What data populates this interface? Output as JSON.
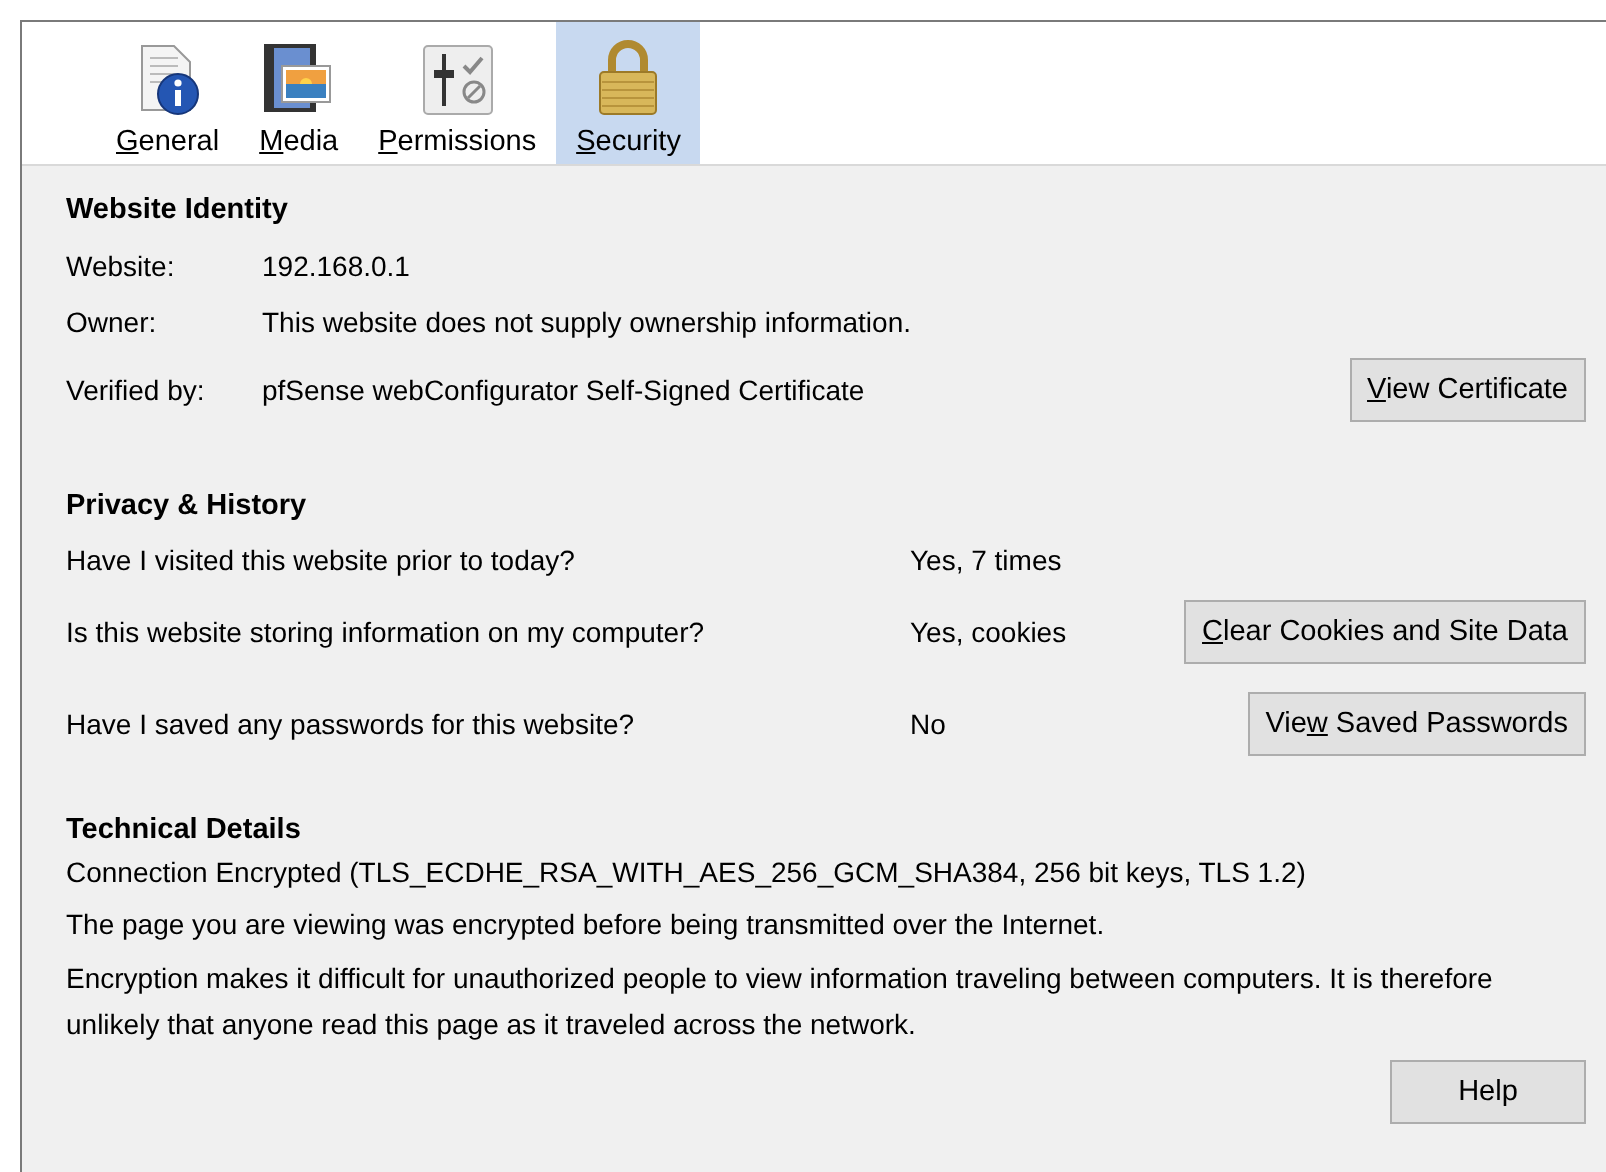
{
  "tabs": [
    {
      "label": "General",
      "selected": false
    },
    {
      "label": "Media",
      "selected": false
    },
    {
      "label": "Permissions",
      "selected": false
    },
    {
      "label": "Security",
      "selected": true
    }
  ],
  "identity": {
    "heading": "Website Identity",
    "rows": [
      {
        "label": "Website:",
        "value": "192.168.0.1"
      },
      {
        "label": "Owner:",
        "value": "This website does not supply ownership information."
      },
      {
        "label": "Verified by:",
        "value": "pfSense webConfigurator Self-Signed Certificate",
        "button": {
          "label": "View Certificate"
        }
      }
    ]
  },
  "privacy": {
    "heading": "Privacy & History",
    "rows": [
      {
        "question": "Have I visited this website prior to today?",
        "answer": "Yes, 7 times"
      },
      {
        "question": "Is this website storing information on my computer?",
        "answer": "Yes, cookies",
        "button": {
          "label": "Clear Cookies and Site Data"
        }
      },
      {
        "question": "Have I saved any passwords for this website?",
        "answer": "No",
        "button": {
          "label": "View Saved Passwords"
        }
      }
    ]
  },
  "technical": {
    "heading": "Technical Details",
    "lines": [
      "Connection Encrypted (TLS_ECDHE_RSA_WITH_AES_256_GCM_SHA384, 256 bit keys, TLS 1.2)",
      "The page you are viewing was encrypted before being transmitted over the Internet.",
      "Encryption makes it difficult for unauthorized people to view information traveling between computers. It is therefore unlikely that anyone read this page as it traveled across the network."
    ]
  },
  "help_button": {
    "label": "Help"
  }
}
